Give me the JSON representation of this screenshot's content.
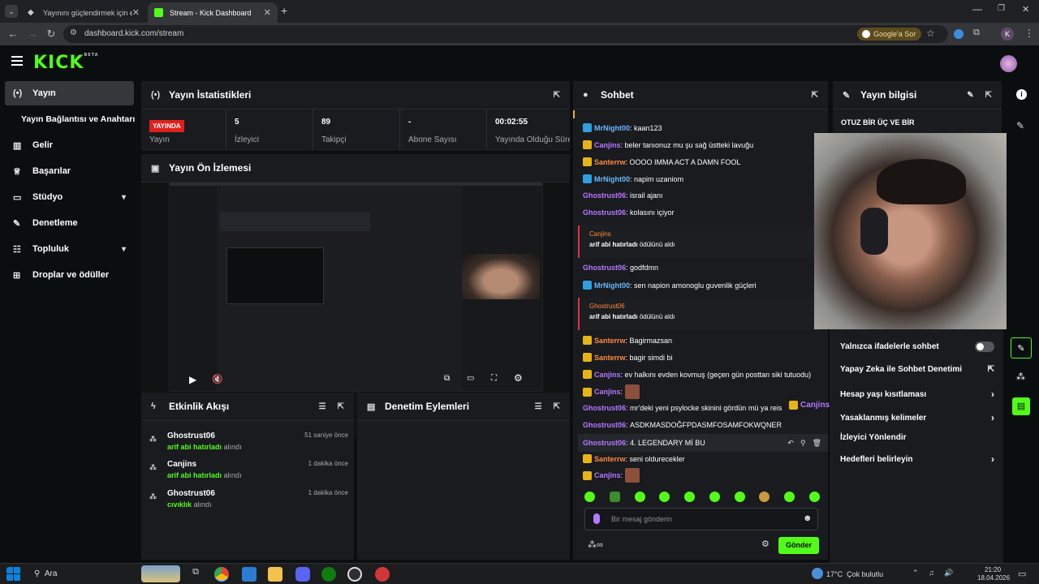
{
  "browser": {
    "tabs": [
      {
        "title": "Yayınını güçlendirmek için en iyi"
      },
      {
        "title": "Stream - Kick Dashboard"
      }
    ],
    "url": "dashboard.kick.com/stream",
    "google_chip": "Google'a Sor",
    "profile_initial": "K"
  },
  "app": {
    "logo": "KICK",
    "logo_tag": "BETA",
    "sidebar": [
      {
        "label": "Yayın",
        "icon": "broadcast-icon"
      },
      {
        "label": "Yayın Bağlantısı ve Anahtarı",
        "icon": ""
      },
      {
        "label": "Gelir",
        "icon": "chart-icon"
      },
      {
        "label": "Başarılar",
        "icon": "trophy-icon"
      },
      {
        "label": "Stüdyo",
        "icon": "studio-icon"
      },
      {
        "label": "Denetleme",
        "icon": "wrench-icon"
      },
      {
        "label": "Topluluk",
        "icon": "people-icon"
      },
      {
        "label": "Droplar ve ödüller",
        "icon": "gift-icon"
      }
    ],
    "stats": {
      "title": "Yayın İstatistikleri",
      "live_badge": "YAYINDA",
      "live_label": "Yayın",
      "viewers": "5",
      "viewers_label": "İzleyici",
      "followers": "89",
      "followers_label": "Takipçi",
      "subs": "-",
      "subs_label": "Abone Sayısı",
      "duration": "00:02:55",
      "duration_label": "Yayında Olduğu Süre"
    },
    "preview": {
      "title": "Yayın Ön İzlemesi"
    },
    "activity": {
      "title": "Etkinlik Akışı",
      "events": [
        {
          "user": "Ghostrust06",
          "reward": "arif abi hatırladı",
          "suffix": "alındı",
          "time": "51 saniye önce"
        },
        {
          "user": "Canjins",
          "reward": "arif abi hatırladı",
          "suffix": "alındı",
          "time": "1 dakika önce"
        },
        {
          "user": "Ghostrust06",
          "reward": "cıvıklık",
          "suffix": "alındı",
          "time": "1 dakika önce"
        }
      ]
    },
    "moderation": {
      "title": "Denetim Eylemleri"
    },
    "chat": {
      "title": "Sohbet",
      "messages": [
        {
          "user": "MrNight00",
          "text": "kaan123"
        },
        {
          "user": "Canjins",
          "text": "beler tanıonuz mu şu sağ üstteki lavuğu"
        },
        {
          "user": "Santerrw",
          "text": "OOOO IMMA ACT A DAMN FOOL"
        },
        {
          "user": "MrNight00",
          "text": "napim uzaniom"
        },
        {
          "user": "Ghostrust06",
          "text": "israil ajanı"
        },
        {
          "user": "Ghostrust06",
          "text": "kolasını içiyor"
        },
        {
          "user": "Ghostrust06",
          "text": "godfdmn"
        },
        {
          "user": "MrNight00",
          "text": "sen napion amonoglu guvenlik güçleri"
        },
        {
          "user": "Santerrw",
          "text": "Bagirmazsan"
        },
        {
          "user": "Santerrw",
          "text": "bagir simdi bi"
        },
        {
          "user": "Canjins",
          "text": "ev halkını evden kovmuş (geçen gün posttan siki tutuodu)"
        },
        {
          "user": "Canjins",
          "text": ""
        },
        {
          "user": "Ghostrust06",
          "text": "mr'deki yeni psylocke skinini gördün mü ya reis"
        },
        {
          "user": "Ghostrust06",
          "text": "ASDKMASDOĞFPDASMFOSAMFOKWQNER"
        },
        {
          "user": "Ghostrust06",
          "text": "4. LEGENDARY Mİ BU"
        },
        {
          "user": "Santerrw",
          "text": "seni oldurecekler"
        },
        {
          "user": "Canjins",
          "text": ""
        }
      ],
      "redemptions": [
        {
          "user": "Canjins",
          "text": "arif abi hatırladı",
          "suffix": "ödülünü aldı"
        },
        {
          "user": "Ghostrust06",
          "text": "arif abi hatırladı",
          "suffix": "ödülünü aldı"
        }
      ],
      "overlay_user": "Canjins",
      "input_placeholder": "Bir mesaj gönderin",
      "send": "Gönder"
    },
    "info": {
      "title": "Yayın bilgisi",
      "stream_title": "OTUZ BİR ÜÇ VE BİR",
      "menu": [
        {
          "label": "Yalnızca ifadelerle sohbet",
          "kind": "toggle"
        },
        {
          "label": "Yapay Zeka ile Sohbet Denetimi",
          "kind": "external"
        },
        {
          "label": "Hesap yaşı kısıtlaması",
          "kind": "chevron"
        },
        {
          "label": "Yasaklanmış kelimeler",
          "kind": "chevron"
        },
        {
          "label": "İzleyici Yönlendir",
          "kind": "none"
        },
        {
          "label": "Hedefleri belirleyin",
          "kind": "chevron"
        }
      ]
    }
  },
  "taskbar": {
    "search": "Ara",
    "weather": "17°C  Çok bulutlu",
    "time": "21:20",
    "date": "18.04.2026"
  },
  "colors": {
    "accent": "#53fc18",
    "live": "#e0201c",
    "panel": "#191b1f"
  }
}
